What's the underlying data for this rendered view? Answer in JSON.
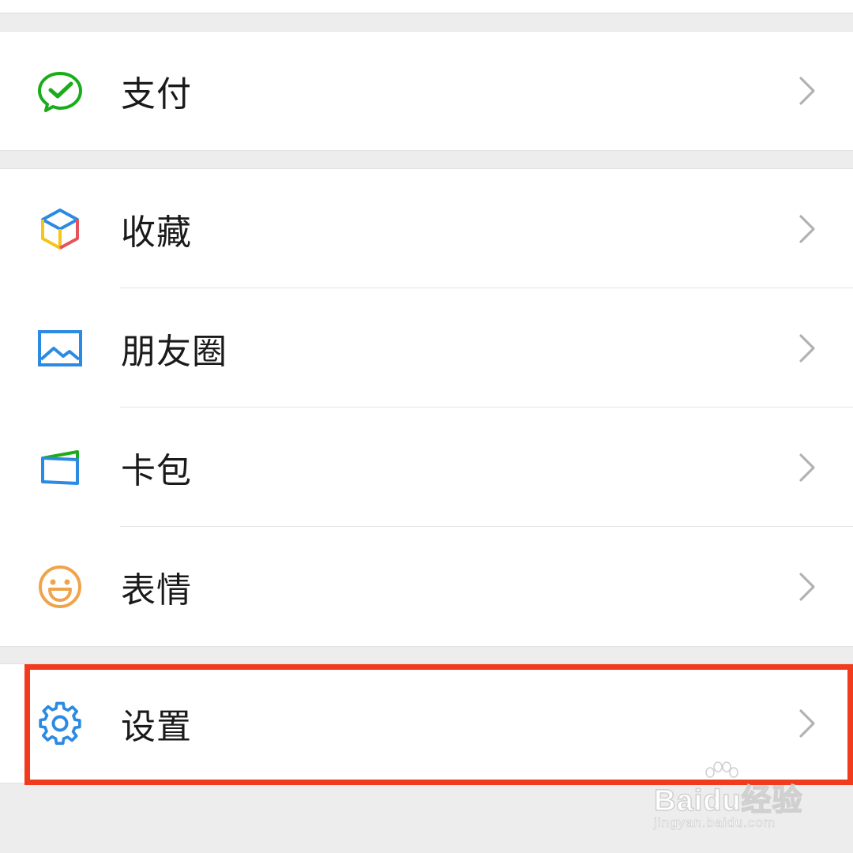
{
  "menu": {
    "groups": [
      {
        "items": [
          {
            "label": "支付",
            "icon": "wechat-pay-icon"
          }
        ]
      },
      {
        "items": [
          {
            "label": "收藏",
            "icon": "favorites-cube-icon"
          },
          {
            "label": "朋友圈",
            "icon": "moments-image-icon"
          },
          {
            "label": "卡包",
            "icon": "card-wallet-icon"
          },
          {
            "label": "表情",
            "icon": "sticker-smile-icon"
          }
        ]
      },
      {
        "items": [
          {
            "label": "设置",
            "icon": "settings-gear-icon"
          }
        ]
      }
    ]
  },
  "annotation": {
    "color": "#f23a1c",
    "target": "设置"
  },
  "watermark": {
    "brand": "Baidu经验",
    "url": "jingyan.baidu.com"
  },
  "colors": {
    "background": "#ededed",
    "row_background": "#ffffff",
    "pay_green": "#1aad19",
    "settings_blue": "#2b8ae2",
    "chevron": "#b2b2b2"
  }
}
